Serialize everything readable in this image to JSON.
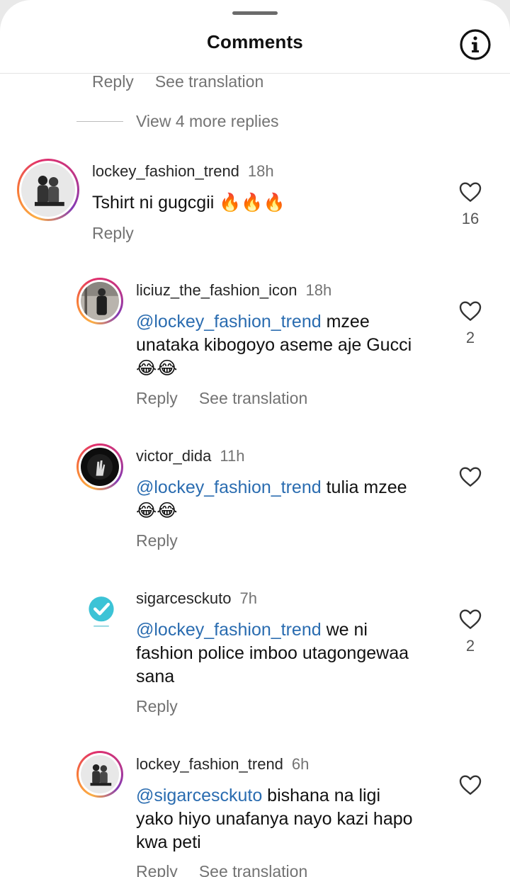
{
  "header": {
    "title": "Comments"
  },
  "top_actions": {
    "reply": "Reply",
    "translate": "See translation"
  },
  "view_more": "View 4 more replies",
  "comments": [
    {
      "username": "lockey_fashion_trend",
      "time": "18h",
      "text": "Tshirt ni gugcgii 🔥🔥🔥",
      "mention": "",
      "reply": "Reply",
      "translate": "",
      "likes": "16"
    },
    {
      "username": "liciuz_the_fashion_icon",
      "time": "18h",
      "mention": "@lockey_fashion_trend",
      "text": " mzee unataka kibogoyo aseme aje Gucci 😂😂",
      "reply": "Reply",
      "translate": "See translation",
      "likes": "2"
    },
    {
      "username": "victor_dida",
      "time": "11h",
      "mention": "@lockey_fashion_trend",
      "text": " tulia mzee😂😂",
      "reply": "Reply",
      "translate": "",
      "likes": ""
    },
    {
      "username": "sigarcesckuto",
      "time": "7h",
      "mention": "@lockey_fashion_trend",
      "text": " we ni fashion police imboo utagongewaa sana",
      "reply": "Reply",
      "translate": "",
      "likes": "2"
    },
    {
      "username": "lockey_fashion_trend",
      "time": "6h",
      "mention": "@sigarcesckuto",
      "text": " bishana na ligi yako hiyo unafanya nayo kazi hapo kwa peti",
      "reply": "Reply",
      "translate": "See translation",
      "likes": ""
    }
  ],
  "colors": {
    "mention": "#2a6cb0",
    "muted": "#737373",
    "verified": "#3cc3d6"
  },
  "icons": {
    "info": "info-circle-icon",
    "like": "heart-outline-icon"
  }
}
